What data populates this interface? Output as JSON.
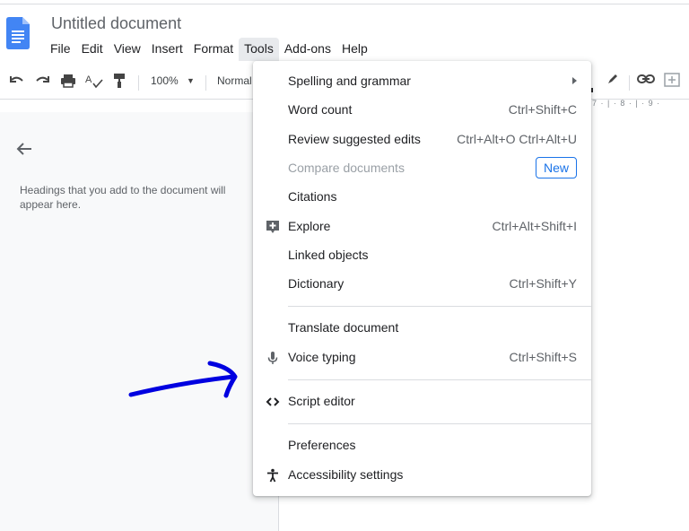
{
  "doc": {
    "title": "Untitled document"
  },
  "menubar": [
    "File",
    "Edit",
    "View",
    "Insert",
    "Format",
    "Tools",
    "Add-ons",
    "Help"
  ],
  "toolbar": {
    "zoom": "100%",
    "style": "Normal"
  },
  "ruler": {
    "ticks": "7 · | · 8 · | · 9 ·"
  },
  "outline": {
    "hint": "Headings that you add to the document will appear here."
  },
  "tools_menu": {
    "items": [
      {
        "label": "Spelling and grammar",
        "submenu": true
      },
      {
        "label": "Word count",
        "shortcut": "Ctrl+Shift+C"
      },
      {
        "label": "Review suggested edits",
        "shortcut": "Ctrl+Alt+O Ctrl+Alt+U"
      },
      {
        "label": "Compare documents",
        "badge": "New",
        "disabled": true
      },
      {
        "label": "Citations"
      },
      {
        "label": "Explore",
        "shortcut": "Ctrl+Alt+Shift+I",
        "icon": "explore-icon"
      },
      {
        "label": "Linked objects"
      },
      {
        "label": "Dictionary",
        "shortcut": "Ctrl+Shift+Y"
      },
      {
        "label": "Translate document"
      },
      {
        "label": "Voice typing",
        "shortcut": "Ctrl+Shift+S",
        "icon": "microphone-icon"
      },
      {
        "label": "Script editor",
        "icon": "code-icon"
      },
      {
        "label": "Preferences"
      },
      {
        "label": "Accessibility settings",
        "icon": "accessibility-icon"
      }
    ]
  },
  "colors": {
    "accent": "#1a73e8",
    "annotation_arrow": "#0000e0",
    "doc_icon": "#4285f4"
  }
}
